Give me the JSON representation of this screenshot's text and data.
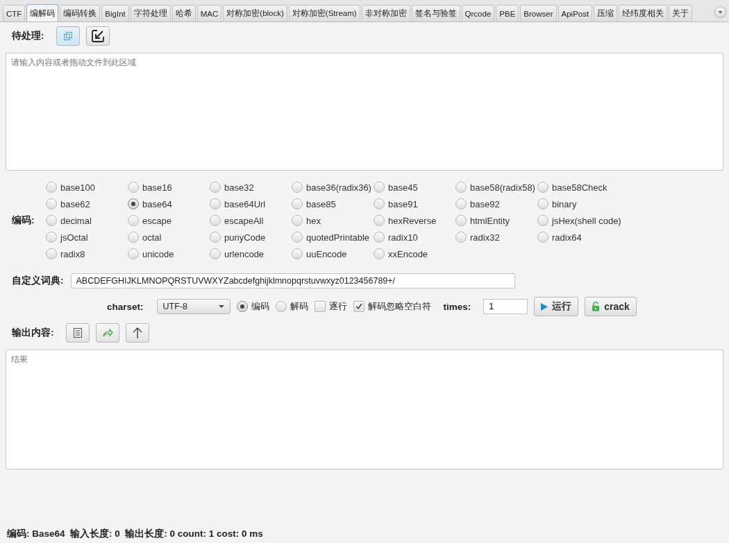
{
  "tabs": [
    {
      "label": "CTF",
      "selected": false
    },
    {
      "label": "编解码",
      "selected": true
    },
    {
      "label": "编码转换",
      "selected": false
    },
    {
      "label": "BigInt",
      "selected": false
    },
    {
      "label": "字符处理",
      "selected": false
    },
    {
      "label": "哈希",
      "selected": false
    },
    {
      "label": "MAC",
      "selected": false
    },
    {
      "label": "对称加密(block)",
      "selected": false
    },
    {
      "label": "对称加密(Stream)",
      "selected": false
    },
    {
      "label": "非对称加密",
      "selected": false
    },
    {
      "label": "签名与验签",
      "selected": false
    },
    {
      "label": "Qrcode",
      "selected": false
    },
    {
      "label": "PBE",
      "selected": false
    },
    {
      "label": "Browser",
      "selected": false
    },
    {
      "label": "ApiPost",
      "selected": false
    },
    {
      "label": "压缩",
      "selected": false
    },
    {
      "label": "经纬度相关",
      "selected": false
    },
    {
      "label": "关于",
      "selected": false
    }
  ],
  "input_section": {
    "label": "待处理:",
    "placeholder": "请输入内容或者拖动文件到此区域"
  },
  "encoding": {
    "label": "编码:",
    "options": [
      {
        "label": "base100",
        "selected": false
      },
      {
        "label": "base16",
        "selected": false
      },
      {
        "label": "base32",
        "selected": false
      },
      {
        "label": "base36(radix36)",
        "selected": false
      },
      {
        "label": "base45",
        "selected": false
      },
      {
        "label": "base58(radix58)",
        "selected": false
      },
      {
        "label": "base58Check",
        "selected": false
      },
      {
        "label": "base62",
        "selected": false
      },
      {
        "label": "base64",
        "selected": true
      },
      {
        "label": "base64Url",
        "selected": false
      },
      {
        "label": "base85",
        "selected": false
      },
      {
        "label": "base91",
        "selected": false
      },
      {
        "label": "base92",
        "selected": false
      },
      {
        "label": "binary",
        "selected": false
      },
      {
        "label": "decimal",
        "selected": false
      },
      {
        "label": "escape",
        "selected": false
      },
      {
        "label": "escapeAll",
        "selected": false
      },
      {
        "label": "hex",
        "selected": false
      },
      {
        "label": "hexReverse",
        "selected": false
      },
      {
        "label": "htmlEntity",
        "selected": false
      },
      {
        "label": "jsHex(shell code)",
        "selected": false
      },
      {
        "label": "jsOctal",
        "selected": false
      },
      {
        "label": "octal",
        "selected": false
      },
      {
        "label": "punyCode",
        "selected": false
      },
      {
        "label": "quotedPrintable",
        "selected": false
      },
      {
        "label": "radix10",
        "selected": false
      },
      {
        "label": "radix32",
        "selected": false
      },
      {
        "label": "radix64",
        "selected": false
      },
      {
        "label": "radix8",
        "selected": false
      },
      {
        "label": "unicode",
        "selected": false
      },
      {
        "label": "urlencode",
        "selected": false
      },
      {
        "label": "uuEncode",
        "selected": false
      },
      {
        "label": "xxEncode",
        "selected": false
      }
    ]
  },
  "dictionary": {
    "label": "自定义词典:",
    "value": "ABCDEFGHIJKLMNOPQRSTUVWXYZabcdefghijklmnopqrstuvwxyz0123456789+/"
  },
  "options_row": {
    "charset_label": "charset:",
    "charset_value": "UTF-8",
    "modes": [
      {
        "label": "编码",
        "selected": true
      },
      {
        "label": "解码",
        "selected": false
      }
    ],
    "checkboxes": [
      {
        "label": "逐行",
        "checked": false
      },
      {
        "label": "解码忽略空白符",
        "checked": true
      }
    ],
    "times_label": "times:",
    "times_value": "1",
    "run_button": "运行",
    "crack_button": "crack"
  },
  "output_section": {
    "label": "输出内容:",
    "placeholder": "结果"
  },
  "status_bar": "编码: Base64  输入长度: 0  输出长度: 0 count: 1 cost: 0 ms"
}
